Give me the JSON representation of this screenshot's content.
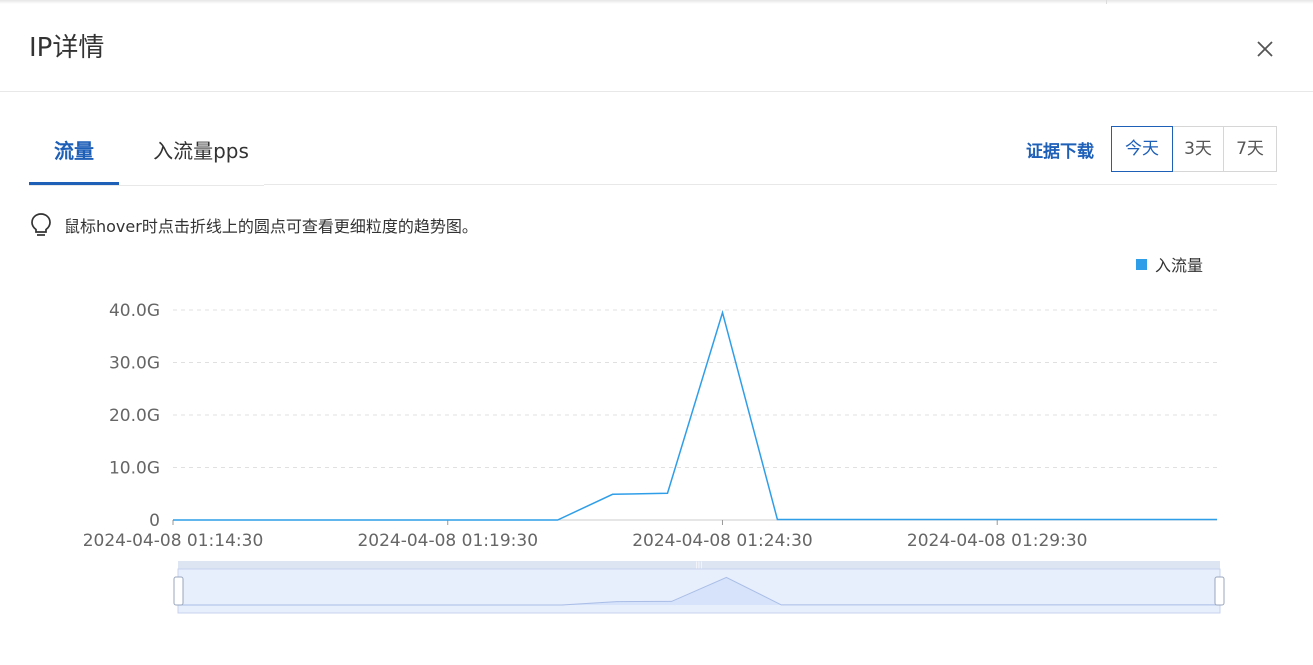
{
  "dialog": {
    "title": "IP详情"
  },
  "tabs": [
    {
      "label": "流量",
      "active": true
    },
    {
      "label": "入流量pps",
      "active": false
    }
  ],
  "toolbar": {
    "download_label": "证据下载",
    "ranges": [
      {
        "label": "今天",
        "active": true
      },
      {
        "label": "3天",
        "active": false
      },
      {
        "label": "7天",
        "active": false
      }
    ]
  },
  "tip": {
    "icon": "lightbulb-icon",
    "text": "鼠标hover时点击折线上的圆点可查看更细粒度的趋势图。"
  },
  "colors": {
    "accent": "#1e5fb8",
    "series": "#2f9ee8",
    "zoom_fill": "#d6e3fa"
  },
  "chart_data": {
    "type": "line",
    "legend": [
      "入流量"
    ],
    "legend_position": "top-right",
    "grid": true,
    "y_unit_suffix": "G",
    "ylim": [
      0,
      40
    ],
    "yticks": [
      "0",
      "10.0G",
      "20.0G",
      "30.0G",
      "40.0G"
    ],
    "xticks": [
      "2024-04-08 01:14:30",
      "2024-04-08 01:19:30",
      "2024-04-08 01:24:30",
      "2024-04-08 01:29:30"
    ],
    "xlim": [
      "2024-04-08 01:14:30",
      "2024-04-08 01:33:30"
    ],
    "series": [
      {
        "name": "入流量",
        "x": [
          "2024-04-08 01:14:30",
          "2024-04-08 01:21:30",
          "2024-04-08 01:22:30",
          "2024-04-08 01:23:30",
          "2024-04-08 01:24:30",
          "2024-04-08 01:25:30",
          "2024-04-08 01:33:30"
        ],
        "values": [
          0,
          0,
          4.9,
          5.1,
          39.5,
          0.1,
          0.1
        ]
      }
    ]
  }
}
